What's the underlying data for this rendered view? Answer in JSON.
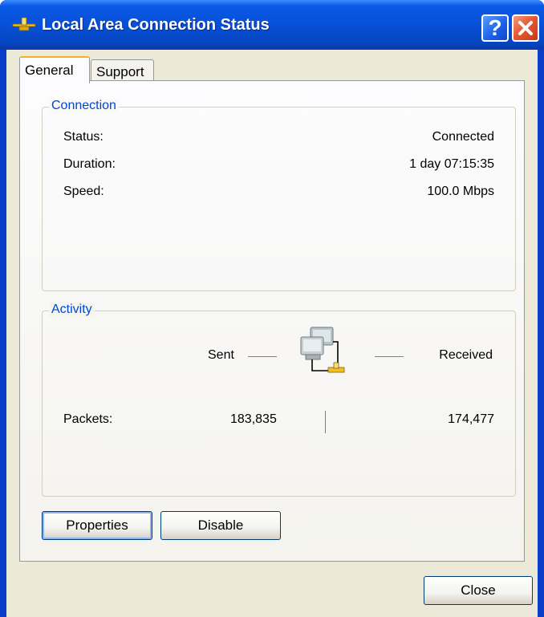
{
  "window": {
    "title": "Local Area Connection Status",
    "help_label": "?",
    "icons": {
      "title": "network-connection-icon",
      "close": "close-icon",
      "help": "help-icon"
    }
  },
  "tabs": [
    {
      "label": "General",
      "active": true
    },
    {
      "label": "Support",
      "active": false
    }
  ],
  "connection": {
    "legend": "Connection",
    "rows": [
      {
        "label": "Status:",
        "value": "Connected"
      },
      {
        "label": "Duration:",
        "value": "1 day 07:15:35"
      },
      {
        "label": "Speed:",
        "value": "100.0 Mbps"
      }
    ]
  },
  "activity": {
    "legend": "Activity",
    "sent_label": "Sent",
    "received_label": "Received",
    "packets_label": "Packets:",
    "packets_sent": "183,835",
    "packets_received": "174,477",
    "icon": "network-activity-icon"
  },
  "buttons": {
    "properties": "Properties",
    "disable": "Disable",
    "close": "Close"
  },
  "colors": {
    "title_bar": "#0850d8",
    "group_legend": "#0046d5",
    "dialog_face": "#ece9d8",
    "close_button": "#e5552e"
  }
}
